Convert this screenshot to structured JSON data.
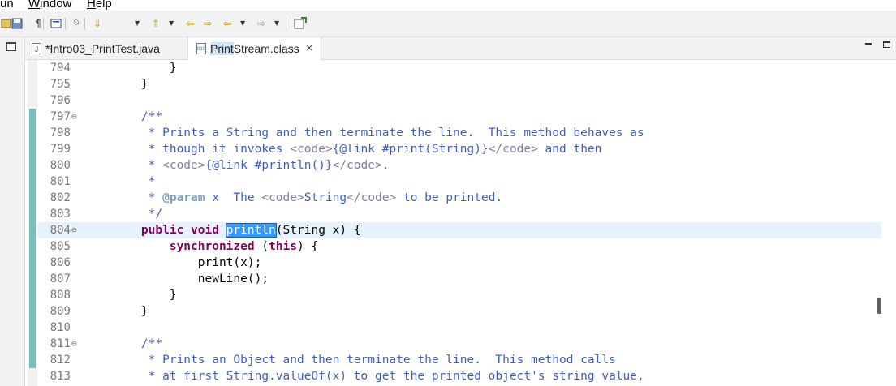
{
  "menu": [
    {
      "text": "un"
    },
    {
      "mnemonic": "W",
      "rest": "indow"
    },
    {
      "mnemonic": "H",
      "rest": "elp"
    }
  ],
  "toolbar": {
    "icons": [
      "build-icon",
      "save-icon",
      "pilcrow-icon",
      "console-icon",
      "skip-breakpoints-icon",
      "next-annotation-icon",
      "previous-annotation-icon",
      "last-edit-location-icon",
      "back-icon",
      "forward-icon",
      "new-task-icon"
    ]
  },
  "tabs": [
    {
      "label": "*Intro03_PrintTest.java",
      "icon": "J",
      "active": false
    },
    {
      "label_selected": "Print",
      "label_rest": "Stream.class",
      "icon": "010",
      "active": true,
      "close": "×"
    }
  ],
  "editor": {
    "lines": [
      {
        "n": "794",
        "fold": "",
        "segs": [
          {
            "t": "        }",
            "k": ""
          }
        ]
      },
      {
        "n": "795",
        "fold": "",
        "segs": [
          {
            "t": "    }",
            "k": ""
          }
        ]
      },
      {
        "n": "796",
        "fold": "",
        "segs": []
      },
      {
        "n": "797",
        "fold": "⊖",
        "segs": [
          {
            "t": "    /**",
            "k": "c"
          }
        ]
      },
      {
        "n": "798",
        "fold": "",
        "segs": [
          {
            "t": "     * Prints a String and then terminate the line.  This method behaves as",
            "k": "c"
          }
        ]
      },
      {
        "n": "799",
        "fold": "",
        "segs": [
          {
            "t": "     * though it invokes ",
            "k": "c"
          },
          {
            "t": "<code>",
            "k": "tag"
          },
          {
            "t": "{@link #print(String)}",
            "k": "c"
          },
          {
            "t": "</code>",
            "k": "tag"
          },
          {
            "t": " and then",
            "k": "c"
          }
        ]
      },
      {
        "n": "800",
        "fold": "",
        "segs": [
          {
            "t": "     * ",
            "k": "c"
          },
          {
            "t": "<code>",
            "k": "tag"
          },
          {
            "t": "{@link #println()}",
            "k": "c"
          },
          {
            "t": "</code>",
            "k": "tag"
          },
          {
            "t": ".",
            "k": "c"
          }
        ]
      },
      {
        "n": "801",
        "fold": "",
        "segs": [
          {
            "t": "     *",
            "k": "c"
          }
        ]
      },
      {
        "n": "802",
        "fold": "",
        "segs": [
          {
            "t": "     * ",
            "k": "c"
          },
          {
            "t": "@param",
            "k": "ann"
          },
          {
            "t": " x  The ",
            "k": "c"
          },
          {
            "t": "<code>",
            "k": "tag"
          },
          {
            "t": "String",
            "k": "c"
          },
          {
            "t": "</code>",
            "k": "tag"
          },
          {
            "t": " to be printed.",
            "k": "c"
          }
        ]
      },
      {
        "n": "803",
        "fold": "",
        "segs": [
          {
            "t": "     */",
            "k": "c"
          }
        ]
      },
      {
        "n": "804",
        "fold": "⊖",
        "current": true,
        "segs": [
          {
            "t": "    ",
            "k": ""
          },
          {
            "t": "public",
            "k": "kw"
          },
          {
            "t": " ",
            "k": ""
          },
          {
            "t": "void",
            "k": "kw"
          },
          {
            "t": " ",
            "k": ""
          },
          {
            "t": "println",
            "k": "sel"
          },
          {
            "t": "(String x) {",
            "k": ""
          }
        ]
      },
      {
        "n": "805",
        "fold": "",
        "segs": [
          {
            "t": "        ",
            "k": ""
          },
          {
            "t": "synchronized",
            "k": "kw"
          },
          {
            "t": " (",
            "k": ""
          },
          {
            "t": "this",
            "k": "kw"
          },
          {
            "t": ") {",
            "k": ""
          }
        ]
      },
      {
        "n": "806",
        "fold": "",
        "segs": [
          {
            "t": "            print(x);",
            "k": ""
          }
        ]
      },
      {
        "n": "807",
        "fold": "",
        "segs": [
          {
            "t": "            newLine();",
            "k": ""
          }
        ]
      },
      {
        "n": "808",
        "fold": "",
        "segs": [
          {
            "t": "        }",
            "k": ""
          }
        ]
      },
      {
        "n": "809",
        "fold": "",
        "segs": [
          {
            "t": "    }",
            "k": ""
          }
        ]
      },
      {
        "n": "810",
        "fold": "",
        "segs": []
      },
      {
        "n": "811",
        "fold": "⊖",
        "segs": [
          {
            "t": "    /**",
            "k": "c"
          }
        ]
      },
      {
        "n": "812",
        "fold": "",
        "segs": [
          {
            "t": "     * Prints an Object and then terminate the line.  This method calls",
            "k": "c"
          }
        ]
      },
      {
        "n": "813",
        "fold": "",
        "segs": [
          {
            "t": "     * at first String.valueOf(x) to get the printed object's string value,",
            "k": "c"
          }
        ]
      }
    ]
  },
  "colors": {
    "keyword": "#7f0055",
    "comment": "#3f5fbf",
    "selection": "#3399ff",
    "current_line": "#e8f2fe"
  }
}
